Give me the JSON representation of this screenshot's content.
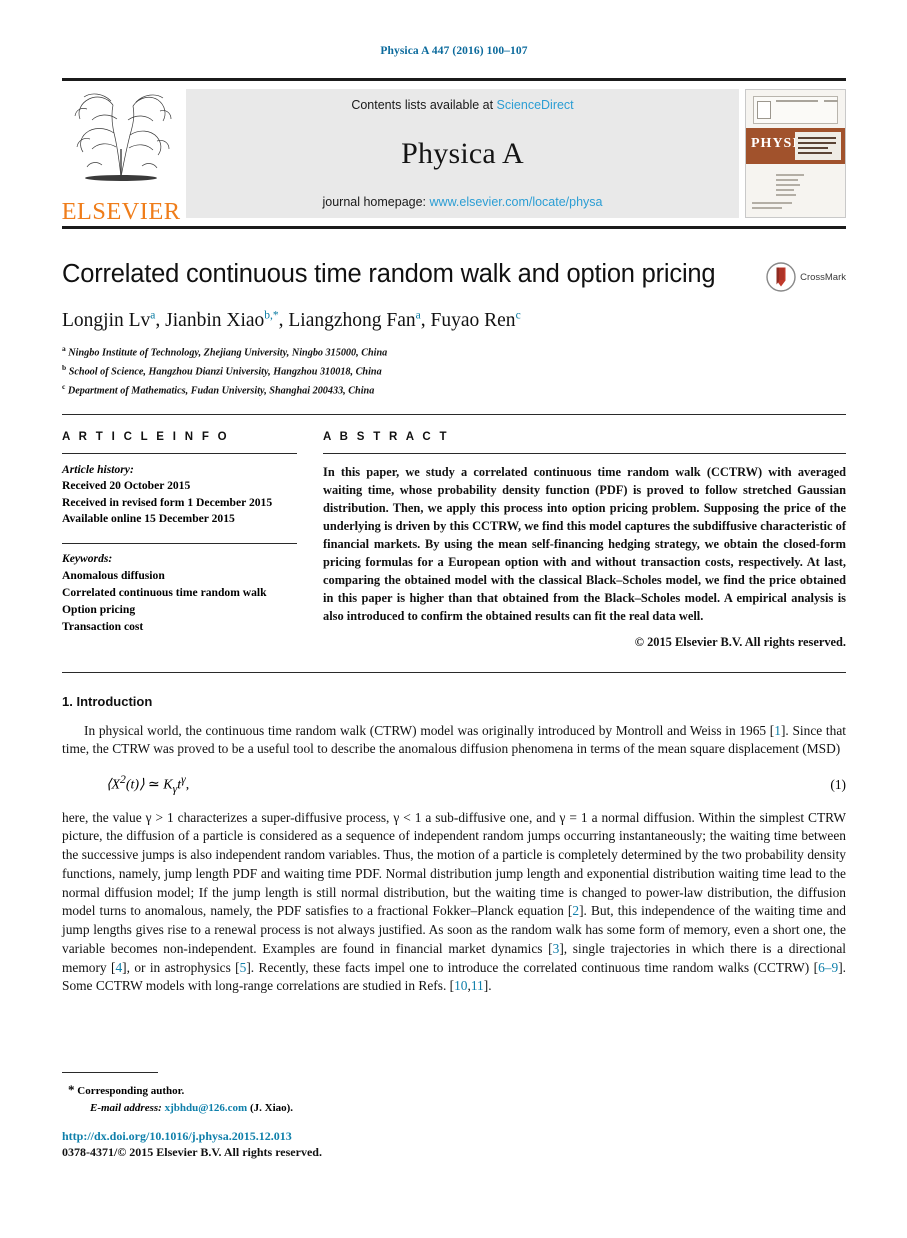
{
  "running_head": "Physica A 447 (2016) 100–107",
  "masthead": {
    "publisher_logo_label": "ELSEVIER",
    "contents_prefix": "Contents lists available at ",
    "contents_link": "ScienceDirect",
    "journal_name": "Physica A",
    "homepage_prefix": "journal homepage: ",
    "homepage_link": "www.elsevier.com/locate/physa",
    "cover_title": "PHYSICA",
    "cover_subtitle": "STATISTICAL MECHANICS AND ITS APPLICATIONS",
    "link_color": "#2c9ed4",
    "elsevier_orange": "#ef7d1a",
    "cover_band_color": "#a1522c"
  },
  "article": {
    "title": "Correlated continuous time random walk and option pricing",
    "crossmark_label": "CrossMark",
    "authors_html": "Longjin Lv<sup>a</sup>, Jianbin Xiao<sup>b,*</sup>, Liangzhong Fan<sup>a</sup>, Fuyao Ren<sup>c</sup>",
    "authors_plain": "Longjin Lv a, Jianbin Xiao b,*, Liangzhong Fan a, Fuyao Ren c",
    "affiliations": [
      {
        "marker": "a",
        "text": "Ningbo Institute of Technology, Zhejiang University, Ningbo 315000, China"
      },
      {
        "marker": "b",
        "text": "School of Science, Hangzhou Dianzi University, Hangzhou 310018, China"
      },
      {
        "marker": "c",
        "text": "Department of Mathematics, Fudan University, Shanghai 200433, China"
      }
    ]
  },
  "article_info": {
    "heading": "A R T I C L E   I N F O",
    "history_label": "Article history:",
    "history": [
      "Received 20 October 2015",
      "Received in revised form 1 December 2015",
      "Available online 15 December 2015"
    ],
    "keywords_label": "Keywords:",
    "keywords": [
      "Anomalous diffusion",
      "Correlated continuous time random walk",
      "Option pricing",
      "Transaction cost"
    ]
  },
  "abstract": {
    "heading": "A B S T R A C T",
    "text": "In this paper, we study a correlated continuous time random walk (CCTRW) with averaged waiting time, whose probability density function (PDF) is proved to follow stretched Gaussian distribution. Then, we apply this process into option pricing problem. Supposing the price of the underlying is driven by this CCTRW, we find this model captures the subdiffusive characteristic of financial markets. By using the mean self-financing hedging strategy, we obtain the closed-form pricing formulas for a European option with and without transaction costs, respectively. At last, comparing the obtained model with the classical Black–Scholes model, we find the price obtained in this paper is higher than that obtained from the Black–Scholes model. A empirical analysis is also introduced to confirm the obtained results can fit the real data well.",
    "copyright": "© 2015 Elsevier B.V. All rights reserved."
  },
  "body": {
    "section_number_title": "1.  Introduction",
    "paragraph1_part1": "In physical world, the continuous time random walk (CTRW) model was originally introduced by Montroll and Weiss in 1965 [",
    "paragraph1_ref1": "1",
    "paragraph1_part2": "]. Since that time, the CTRW was proved to be a useful tool to describe the anomalous diffusion phenomena in terms of the mean square displacement (MSD)",
    "equation": "⟨X²(t)⟩ ≃ Kγtγ,",
    "equation_number": "(1)",
    "paragraph2": [
      {
        "t": "here, the value γ > 1 characterizes a super-diffusive process, γ < 1 a sub-diffusive one, and γ = 1 a normal diffusion. Within the simplest CTRW picture, the diffusion of a particle is considered as a sequence of independent random jumps occurring instantaneously; the waiting time between the successive jumps is also independent random variables. Thus, the motion of a particle is completely determined by the two probability density functions, namely, jump length PDF and waiting time PDF. Normal distribution jump length and exponential distribution waiting time lead to the normal diffusion model; If the jump length is still normal distribution, but the waiting time is changed to power-law distribution, the diffusion model turns to anomalous, namely, the PDF satisfies to a fractional Fokker–Planck equation ["
      },
      {
        "r": "2"
      },
      {
        "t": "]. But, this independence of the waiting time and jump lengths gives rise to a renewal process is not always justified. As soon as the random walk has some form of memory, even a short one, the variable becomes non-independent. Examples are found in financial market dynamics ["
      },
      {
        "r": "3"
      },
      {
        "t": "], single trajectories in which there is a directional memory ["
      },
      {
        "r": "4"
      },
      {
        "t": "], or in astrophysics ["
      },
      {
        "r": "5"
      },
      {
        "t": "]. Recently, these facts impel one to introduce the correlated continuous time random walks (CCTRW) ["
      },
      {
        "r": "6–9"
      },
      {
        "t": "]. Some CCTRW models with long-range correlations are studied in Refs. ["
      },
      {
        "r": "10"
      },
      {
        "t": ","
      },
      {
        "r": "11"
      },
      {
        "t": "]."
      }
    ]
  },
  "footnotes": {
    "corresponding_star": "*",
    "corresponding_text": "Corresponding author.",
    "email_label": "E-mail address:",
    "email_address": "xjbhdu@126.com",
    "email_owner": "(J. Xiao).",
    "doi": "http://dx.doi.org/10.1016/j.physa.2015.12.013",
    "issn_line": "0378-4371/© 2015 Elsevier B.V. All rights reserved."
  }
}
